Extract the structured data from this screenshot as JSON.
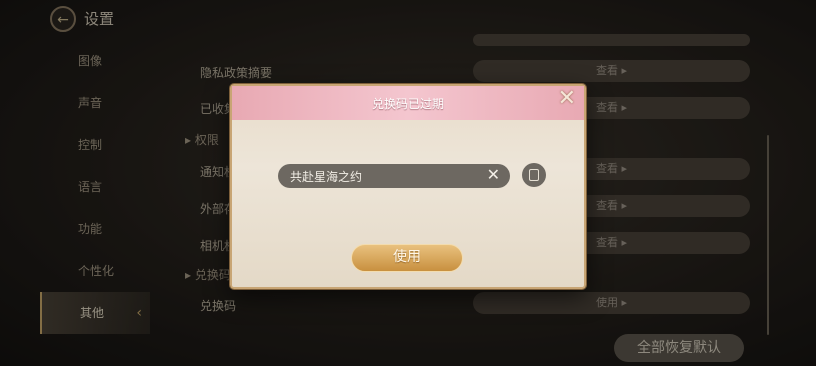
{
  "header": {
    "back_icon": "back-arrow-icon",
    "title": "设置"
  },
  "sidebar": {
    "items": [
      {
        "label": "图像"
      },
      {
        "label": "声音"
      },
      {
        "label": "控制"
      },
      {
        "label": "语言"
      },
      {
        "label": "功能"
      },
      {
        "label": "个性化"
      },
      {
        "label": "其他",
        "active": true
      }
    ]
  },
  "settings": {
    "rows": [
      {
        "label": "隐私政策摘要",
        "action": "查看 ▸"
      },
      {
        "label": "已收集",
        "action": "查看 ▸"
      },
      {
        "section": "权限"
      },
      {
        "label": "通知权",
        "action": "查看 ▸"
      },
      {
        "label": "外部存",
        "action": "查看 ▸"
      },
      {
        "label": "相机权",
        "action": "查看 ▸"
      },
      {
        "section": "兑换码"
      },
      {
        "label": "兑换码",
        "action": "使用 ▸"
      }
    ],
    "reset_label": "全部恢复默认"
  },
  "modal": {
    "title": "兑换码已过期",
    "input_value": "共赴星海之约",
    "clear_icon": "close-icon",
    "paste_icon": "clipboard-icon",
    "use_label": "使用",
    "close_icon": "close-icon"
  },
  "colors": {
    "accent_gold": "#c8903f",
    "header_pink": "#f4c6cf",
    "panel_bg": "#ede5d8"
  }
}
